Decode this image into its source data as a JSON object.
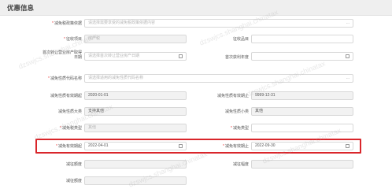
{
  "section": {
    "title": "优惠信息"
  },
  "rows": {
    "r1": {
      "l1": "减免税政策依据",
      "f1_ph": "请选择需要享受的减免税政策依据内容",
      "f1_suffix": "..."
    },
    "r2": {
      "l1": "征收项目",
      "f1_ph": "房产税",
      "l2": "征收品目",
      "f2_ph": ""
    },
    "r3": {
      "l1": "首次转让营业房产取得日期",
      "f1_ph": "请选择首次转让营业房产日期",
      "l2": "首次获利年度",
      "f2_ph": ""
    },
    "r4": {
      "l1": "减免性质代码名称",
      "f1_ph": "请选择适用的减免性质代码名称",
      "f1_suffix": "..."
    },
    "r5": {
      "l1": "减免性质有效期起",
      "f1": "2020-01-01",
      "l2": "减免性质有效期止",
      "f2": "9999-12-31"
    },
    "r6": {
      "l1": "减免性质大类",
      "f1": "支持其他",
      "l2": "减免性质小类",
      "f2": "其他"
    },
    "r7": {
      "l1": "减免税类型",
      "f1_ph": "其他",
      "l2": "减免类型",
      "f2_ph": ""
    },
    "r8": {
      "l1": "减免有效期起",
      "f1": "2022-04-01",
      "l2": "减免有效期止",
      "f2": "2022-09-30"
    },
    "r9": {
      "l1": "减征额度",
      "l2": "减征幅度"
    },
    "r10": {
      "l1": "减征额度"
    }
  },
  "watermark": "dzswjcs.shanghai.chinatax",
  "colors": {
    "highlight": "#d9262b",
    "required": "#e94040"
  }
}
